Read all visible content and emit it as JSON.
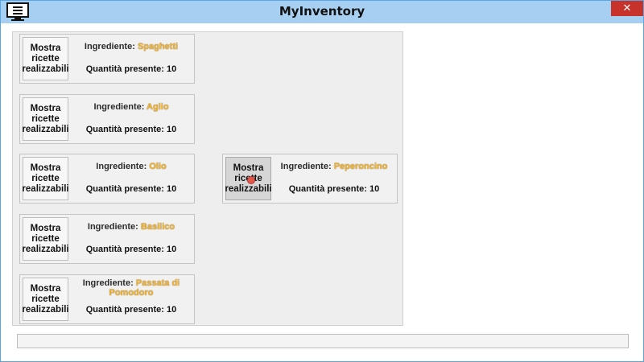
{
  "window": {
    "title": "MyInventory",
    "close_glyph": "✕",
    "app_icon": "monitor-icon",
    "accent_color": "#a7cff1",
    "close_color": "#c7322b"
  },
  "common": {
    "button_label": "Mostra ricette realizzabili",
    "ingredient_prefix": "Ingrediente: ",
    "quantity_prefix": "Quantità presente: "
  },
  "ingredients": [
    {
      "name": "Spaghetti",
      "quantity": "10"
    },
    {
      "name": "Aglio",
      "quantity": "10"
    },
    {
      "name": "Olio",
      "quantity": "10"
    },
    {
      "name": "Peperoncino",
      "quantity": "10"
    },
    {
      "name": "Basilico",
      "quantity": "10"
    },
    {
      "name": "Passata di Pomodoro",
      "quantity": "10"
    }
  ]
}
